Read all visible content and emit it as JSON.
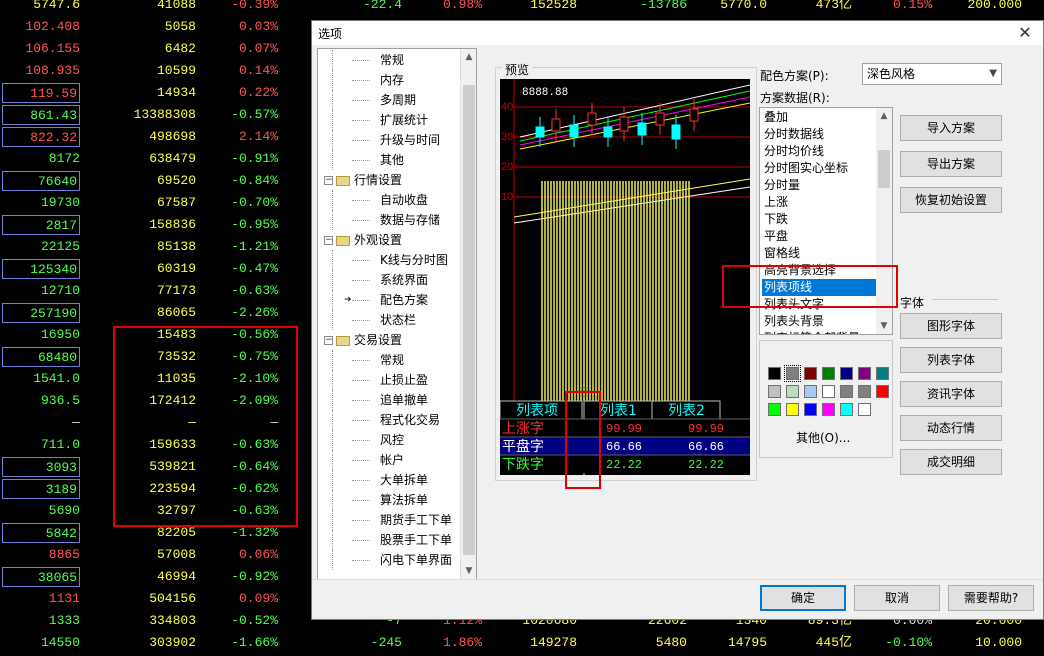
{
  "background_rows": [
    {
      "c1": "5747.6",
      "c2": "41088",
      "c3": "-0.39%",
      "c1c": "yl",
      "c3c": "up",
      "box": false,
      "tail": [
        {
          "t": "-22.4",
          "c": "dn",
          "l": 0
        },
        {
          "t": "0.98%",
          "c": "up",
          "l": 80
        },
        {
          "t": "152528",
          "c": "yl",
          "l": 175
        },
        {
          "t": "-13786",
          "c": "dn",
          "l": 285
        },
        {
          "t": "5770.0",
          "c": "yl",
          "l": 365
        },
        {
          "t": "473亿",
          "c": "yl",
          "l": 450
        },
        {
          "t": "0.15%",
          "c": "up",
          "l": 530
        },
        {
          "t": "200.000",
          "c": "yl",
          "l": 620
        }
      ]
    },
    {
      "c1": "102.408",
      "c2": "5058",
      "c3": "0.03%",
      "c1c": "up",
      "c3c": "up",
      "box": false
    },
    {
      "c1": "106.155",
      "c2": "6482",
      "c3": "0.07%",
      "c1c": "up",
      "c3c": "up",
      "box": false
    },
    {
      "c1": "108.935",
      "c2": "10599",
      "c3": "0.14%",
      "c1c": "up",
      "c3c": "up",
      "box": false
    },
    {
      "c1": "119.59",
      "c2": "14934",
      "c3": "0.22%",
      "c1c": "up",
      "c3c": "up",
      "box": true
    },
    {
      "c1": "861.43",
      "c2": "13388308",
      "c3": "-0.57%",
      "c1c": "dn",
      "c3c": "dn",
      "box": true
    },
    {
      "c1": "822.32",
      "c2": "498698",
      "c3": "2.14%",
      "c1c": "up",
      "c3c": "up",
      "box": true
    },
    {
      "c1": "8172",
      "c2": "638479",
      "c3": "-0.91%",
      "c1c": "dn",
      "c3c": "dn",
      "box": false
    },
    {
      "c1": "76640",
      "c2": "69520",
      "c3": "-0.84%",
      "c1c": "dn",
      "c3c": "dn",
      "box": true
    },
    {
      "c1": "19730",
      "c2": "67587",
      "c3": "-0.70%",
      "c1c": "dn",
      "c3c": "dn",
      "box": false
    },
    {
      "c1": "2817",
      "c2": "158836",
      "c3": "-0.95%",
      "c1c": "dn",
      "c3c": "dn",
      "box": true
    },
    {
      "c1": "22125",
      "c2": "85138",
      "c3": "-1.21%",
      "c1c": "dn",
      "c3c": "dn",
      "box": false
    },
    {
      "c1": "125340",
      "c2": "60319",
      "c3": "-0.47%",
      "c1c": "dn",
      "c3c": "dn",
      "box": true
    },
    {
      "c1": "12710",
      "c2": "77173",
      "c3": "-0.63%",
      "c1c": "dn",
      "c3c": "dn",
      "box": false
    },
    {
      "c1": "257190",
      "c2": "86065",
      "c3": "-2.26%",
      "c1c": "dn",
      "c3c": "dn",
      "box": true
    },
    {
      "c1": "16950",
      "c2": "15483",
      "c3": "-0.56%",
      "c1c": "dn",
      "c3c": "dn",
      "box": false
    },
    {
      "c1": "68480",
      "c2": "73532",
      "c3": "-0.75%",
      "c1c": "dn",
      "c3c": "dn",
      "box": true
    },
    {
      "c1": "1541.0",
      "c2": "11035",
      "c3": "-2.10%",
      "c1c": "dn",
      "c3c": "dn",
      "box": false
    },
    {
      "c1": "936.5",
      "c2": "172412",
      "c3": "-2.09%",
      "c1c": "dn",
      "c3c": "dn",
      "box": false
    },
    {
      "c1": "—",
      "c2": "—",
      "c3": "—",
      "c1c": "eq",
      "c3c": "eq",
      "box": false
    },
    {
      "c1": "711.0",
      "c2": "159633",
      "c3": "-0.63%",
      "c1c": "dn",
      "c3c": "dn",
      "box": false
    },
    {
      "c1": "3093",
      "c2": "539821",
      "c3": "-0.64%",
      "c1c": "dn",
      "c3c": "dn",
      "box": true
    },
    {
      "c1": "3189",
      "c2": "223594",
      "c3": "-0.62%",
      "c1c": "dn",
      "c3c": "dn",
      "box": true
    },
    {
      "c1": "5690",
      "c2": "32797",
      "c3": "-0.63%",
      "c1c": "dn",
      "c3c": "dn",
      "box": false
    },
    {
      "c1": "5842",
      "c2": "82205",
      "c3": "-1.32%",
      "c1c": "dn",
      "c3c": "dn",
      "box": true
    },
    {
      "c1": "8865",
      "c2": "57008",
      "c3": "0.06%",
      "c1c": "up",
      "c3c": "up",
      "box": false
    },
    {
      "c1": "38065",
      "c2": "46994",
      "c3": "-0.92%",
      "c1c": "dn",
      "c3c": "dn",
      "box": true
    },
    {
      "c1": "1131",
      "c2": "504156",
      "c3": "0.09%",
      "c1c": "up",
      "c3c": "up",
      "box": false
    },
    {
      "c1": "1333",
      "c2": "334803",
      "c3": "-0.52%",
      "c1c": "dn",
      "c3c": "dn",
      "box": false,
      "tail": [
        {
          "t": "-7",
          "c": "dn",
          "l": 0
        },
        {
          "t": "1.12%",
          "c": "up",
          "l": 80
        },
        {
          "t": "1020680",
          "c": "yl",
          "l": 175
        },
        {
          "t": "22602",
          "c": "yl",
          "l": 285
        },
        {
          "t": "1340",
          "c": "yl",
          "l": 365
        },
        {
          "t": "89.3亿",
          "c": "yl",
          "l": 450
        },
        {
          "t": "0.00%",
          "c": "eq",
          "l": 530
        },
        {
          "t": "20.000",
          "c": "yl",
          "l": 620
        }
      ]
    },
    {
      "c1": "14550",
      "c2": "303902",
      "c3": "-1.66%",
      "c1c": "dn",
      "c3c": "dn",
      "box": false,
      "tail": [
        {
          "t": "-245",
          "c": "dn",
          "l": 0
        },
        {
          "t": "1.86%",
          "c": "up",
          "l": 80
        },
        {
          "t": "149278",
          "c": "yl",
          "l": 175
        },
        {
          "t": "5480",
          "c": "yl",
          "l": 285
        },
        {
          "t": "14795",
          "c": "yl",
          "l": 365
        },
        {
          "t": "445亿",
          "c": "yl",
          "l": 450
        },
        {
          "t": "-0.10%",
          "c": "dn",
          "l": 530
        },
        {
          "t": "10.000",
          "c": "yl",
          "l": 620
        }
      ]
    }
  ],
  "dialog": {
    "title": "选项",
    "close_glyph": "✕",
    "tree": [
      {
        "label": "常规",
        "level": 1
      },
      {
        "label": "内存",
        "level": 1
      },
      {
        "label": "多周期",
        "level": 1
      },
      {
        "label": "扩展统计",
        "level": 1
      },
      {
        "label": "升级与时间",
        "level": 1
      },
      {
        "label": "其他",
        "level": 1
      },
      {
        "label": "行情设置",
        "level": 0
      },
      {
        "label": "自动收盘",
        "level": 1
      },
      {
        "label": "数据与存储",
        "level": 1
      },
      {
        "label": "外观设置",
        "level": 0
      },
      {
        "label": "K线与分时图",
        "level": 1
      },
      {
        "label": "系统界面",
        "level": 1
      },
      {
        "label": "配色方案",
        "level": 1,
        "current": true
      },
      {
        "label": "状态栏",
        "level": 1
      },
      {
        "label": "交易设置",
        "level": 0
      },
      {
        "label": "常规",
        "level": 1
      },
      {
        "label": "止损止盈",
        "level": 1
      },
      {
        "label": "追单撤单",
        "level": 1
      },
      {
        "label": "程式化交易",
        "level": 1
      },
      {
        "label": "风控",
        "level": 1
      },
      {
        "label": "帐户",
        "level": 1
      },
      {
        "label": "大单拆单",
        "level": 1
      },
      {
        "label": "算法拆单",
        "level": 1
      },
      {
        "label": "期货手工下单",
        "level": 1
      },
      {
        "label": "股票手工下单",
        "level": 1
      },
      {
        "label": "闪电下单界面",
        "level": 1
      }
    ],
    "preview": {
      "group_label": "预览",
      "price_label": "8888.88",
      "axis_ticks": [
        "40",
        "30",
        "20",
        "10"
      ],
      "table_headers": [
        "列表项",
        "列表1",
        "列表2"
      ],
      "table_rows": [
        {
          "label": "上涨字",
          "v1": "99.99",
          "v2": "99.99",
          "color": "#ff3030",
          "bg": "#000"
        },
        {
          "label": "平盘字",
          "v1": "66.66",
          "v2": "66.66",
          "color": "#ffffff",
          "bg": "#000080"
        },
        {
          "label": "下跌字",
          "v1": "22.22",
          "v2": "22.22",
          "color": "#30ff30",
          "bg": "#000"
        }
      ],
      "colors": {
        "up": "#ff3030",
        "down": "#00ffff",
        "grid": "#c00000",
        "bars": "#ffff60",
        "header": "#00ffff"
      }
    },
    "scheme_label": "配色方案(P):",
    "scheme_value": "深色风格",
    "data_label": "方案数据(R):",
    "data_items": [
      "叠加",
      "分时数据线",
      "分时均价线",
      "分时图实心坐标",
      "分时量",
      "上涨",
      "下跌",
      "平盘",
      "窗格线",
      "高亮背景选择",
      "列表项线",
      "列表头文字",
      "列表头背景",
      "列表标签全部背景"
    ],
    "data_selected": "列表项线",
    "buttons_right": [
      "导入方案",
      "导出方案",
      "恢复初始设置"
    ],
    "font_label": "字体",
    "font_buttons": [
      "图形字体",
      "列表字体",
      "资讯字体",
      "动态行情",
      "成交明细"
    ],
    "palette": [
      "#000000",
      "#808080",
      "#800000",
      "#008000",
      "#000080",
      "#800080",
      "#008080",
      "#c0c0c0",
      "#c0dcc0",
      "#a6caf0",
      "#ffffff",
      "#808080",
      "#808080",
      "#ff0000",
      "#00ff00",
      "#ffff00",
      "#0000ff",
      "#ff00ff",
      "#00ffff",
      "#ffffff"
    ],
    "other_label": "其他(O)...",
    "ok": "确定",
    "cancel": "取消",
    "help": "需要帮助?"
  }
}
